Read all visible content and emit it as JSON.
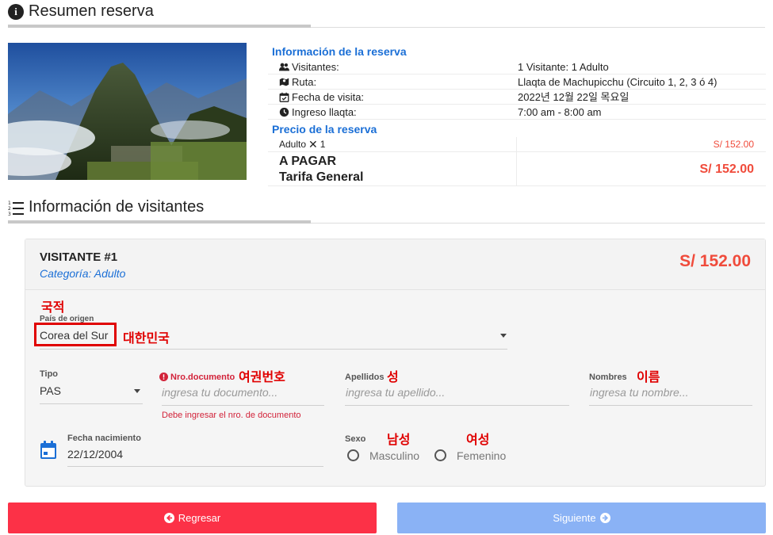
{
  "summary": {
    "title": "Resumen reserva",
    "booking_info_heading": "Información de la reserva",
    "rows": [
      {
        "label": "Visitantes:",
        "value": "1 Visitante: 1 Adulto",
        "icon": "users-icon"
      },
      {
        "label": "Ruta:",
        "value": "Llaqta de Machupicchu (Circuito 1, 2, 3 ó 4)",
        "icon": "map-route-icon"
      },
      {
        "label": "Fecha de visita:",
        "value": "2022년 12월 22일 목요일",
        "icon": "calendar-check-icon"
      },
      {
        "label": "Ingreso llaqta:",
        "value": "7:00 am - 8:00 am",
        "icon": "clock-icon"
      }
    ],
    "price_heading": "Precio de la reserva",
    "price_line": {
      "label": "Adulto",
      "qty": "1",
      "value": "S/ 152.00"
    },
    "pay_label_1": "A PAGAR",
    "pay_label_2": "Tarifa General",
    "pay_total": "S/ 152.00"
  },
  "visitors_section": {
    "title": "Información de visitantes"
  },
  "visitor": {
    "title": "VISITANTE #1",
    "category": "Categoría: Adulto",
    "price": "S/ 152.00",
    "country_label": "País de origen",
    "country_value": "Corea del Sur",
    "tipo_label": "Tipo",
    "tipo_value": "PAS",
    "doc_label": "Nro.documento",
    "doc_placeholder": "ingresa tu documento...",
    "doc_error": "Debe ingresar el nro. de documento",
    "apellidos_label": "Apellidos",
    "apellidos_placeholder": "ingresa tu apellido...",
    "nombres_label": "Nombres",
    "nombres_placeholder": "ingresa tu nombre...",
    "birth_label": "Fecha nacimiento",
    "birth_value": "22/12/2004",
    "sex_label": "Sexo",
    "sex_options": [
      "Masculino",
      "Femenino"
    ]
  },
  "annotations": {
    "country": "국적",
    "country_value": "대한민국",
    "doc": "여권번호",
    "surname": "성",
    "name": "이름",
    "male": "남성",
    "female": "여성"
  },
  "buttons": {
    "back": "Regresar",
    "next": "Siguiente"
  },
  "colors": {
    "accent_blue": "#1b6fd6",
    "price_red": "#f04b3b",
    "back_button": "#fc3147",
    "next_button": "#8ab2f5",
    "annotation_red": "#e00000"
  }
}
